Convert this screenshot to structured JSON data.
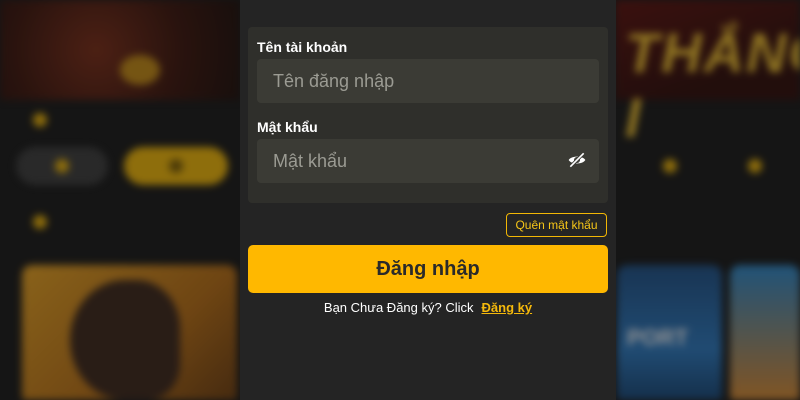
{
  "login_form": {
    "username_label": "Tên tài khoản",
    "username_placeholder": "Tên đăng nhập",
    "username_value": "",
    "password_label": "Mật khẩu",
    "password_placeholder": "Mật khẩu",
    "password_value": "",
    "password_toggle_icon": "eye-slash-icon",
    "forgot_password_label": "Quên mật khẩu",
    "login_button_label": "Đăng nhập",
    "register_prompt": "Bạn Chưa Đăng ký? Click",
    "register_link_label": "Đăng ký"
  },
  "background": {
    "banner_text": "THẮNG I",
    "card_text": "PORT"
  },
  "colors": {
    "accent": "#ffb800",
    "modal_background": "#242424",
    "panel_background": "#2f2f2b",
    "input_background": "#3b3b35",
    "link": "#f5b90b"
  }
}
